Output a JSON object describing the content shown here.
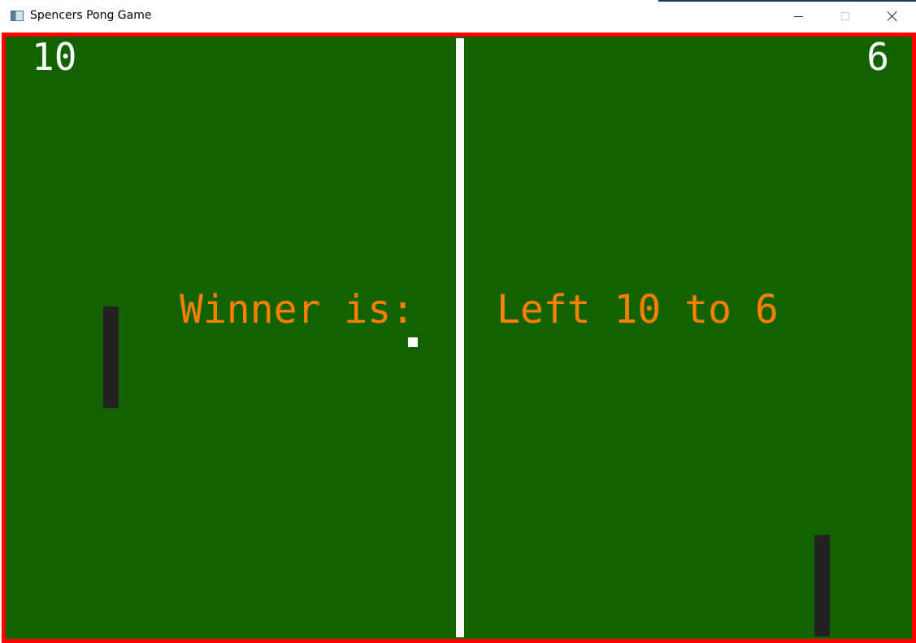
{
  "window": {
    "title": "Spencers Pong Game",
    "icon": "app-window-icon"
  },
  "controls": {
    "minimize_icon": "minimize-icon",
    "maximize_icon": "maximize-icon",
    "close_icon": "close-icon"
  },
  "game": {
    "left_score": "10",
    "right_score": "6",
    "winner_label": "Winner is:",
    "winner_result": "Left 10 to 6"
  },
  "colors": {
    "field": "#126300",
    "border": "#ff0000",
    "net": "#ffffff",
    "paddle": "#222222",
    "ball": "#ffffff",
    "score_text": "#ffffff",
    "winner_text": "#ff8000"
  }
}
